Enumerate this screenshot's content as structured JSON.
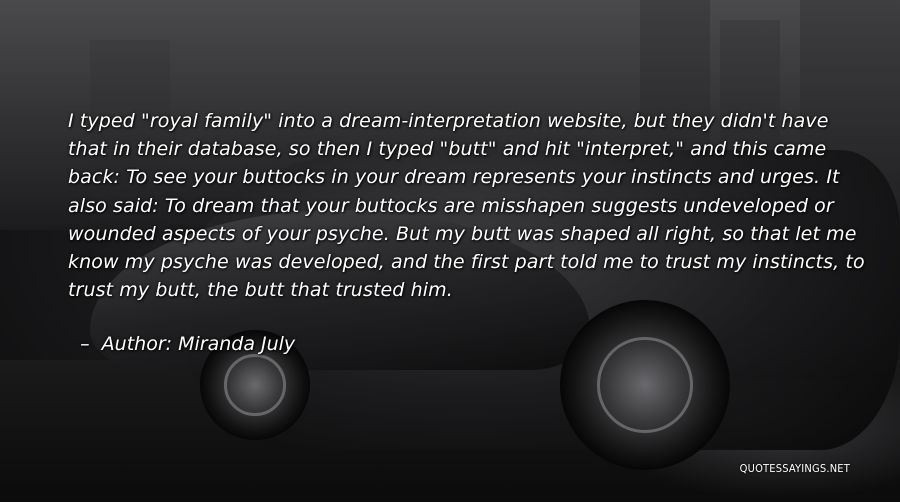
{
  "quote": {
    "text": "I typed \"royal family\" into a dream-interpretation website, but they didn't have that in their database, so then I typed \"butt\" and hit \"interpret,\" and this came back: To see your buttocks in your dream represents your instincts and urges. It also said: To dream that your buttocks are misshapen suggests undeveloped or wounded aspects of your psyche. But my butt was shaped all right, so that let me know my psyche was developed, and the first part told me to trust my instincts, to trust my butt, the butt that trusted him.",
    "author_prefix": "Author:",
    "author": "Miranda July"
  },
  "watermark": "QUOTESSAYINGS.NET"
}
